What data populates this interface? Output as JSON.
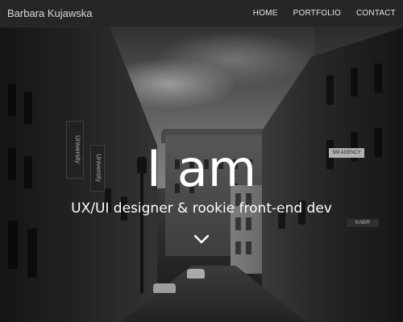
{
  "navbar": {
    "brand": "Barbara Kujawska",
    "links": [
      {
        "label": "HOME"
      },
      {
        "label": "PORTFOLIO"
      },
      {
        "label": "CONTACT"
      }
    ]
  },
  "hero": {
    "headline": "I am",
    "subline": "UX/UI designer & rookie front-end dev",
    "scroll_icon": "chevron-down-icon",
    "background_signs": {
      "banner_left_1": "University",
      "banner_left_2": "University",
      "sign_right_1": "SM AGENCY",
      "sign_right_2": "KABIR"
    }
  },
  "colors": {
    "navbar_bg": "#262626",
    "text_primary": "#ffffff",
    "nav_text": "#e6e6e6"
  }
}
